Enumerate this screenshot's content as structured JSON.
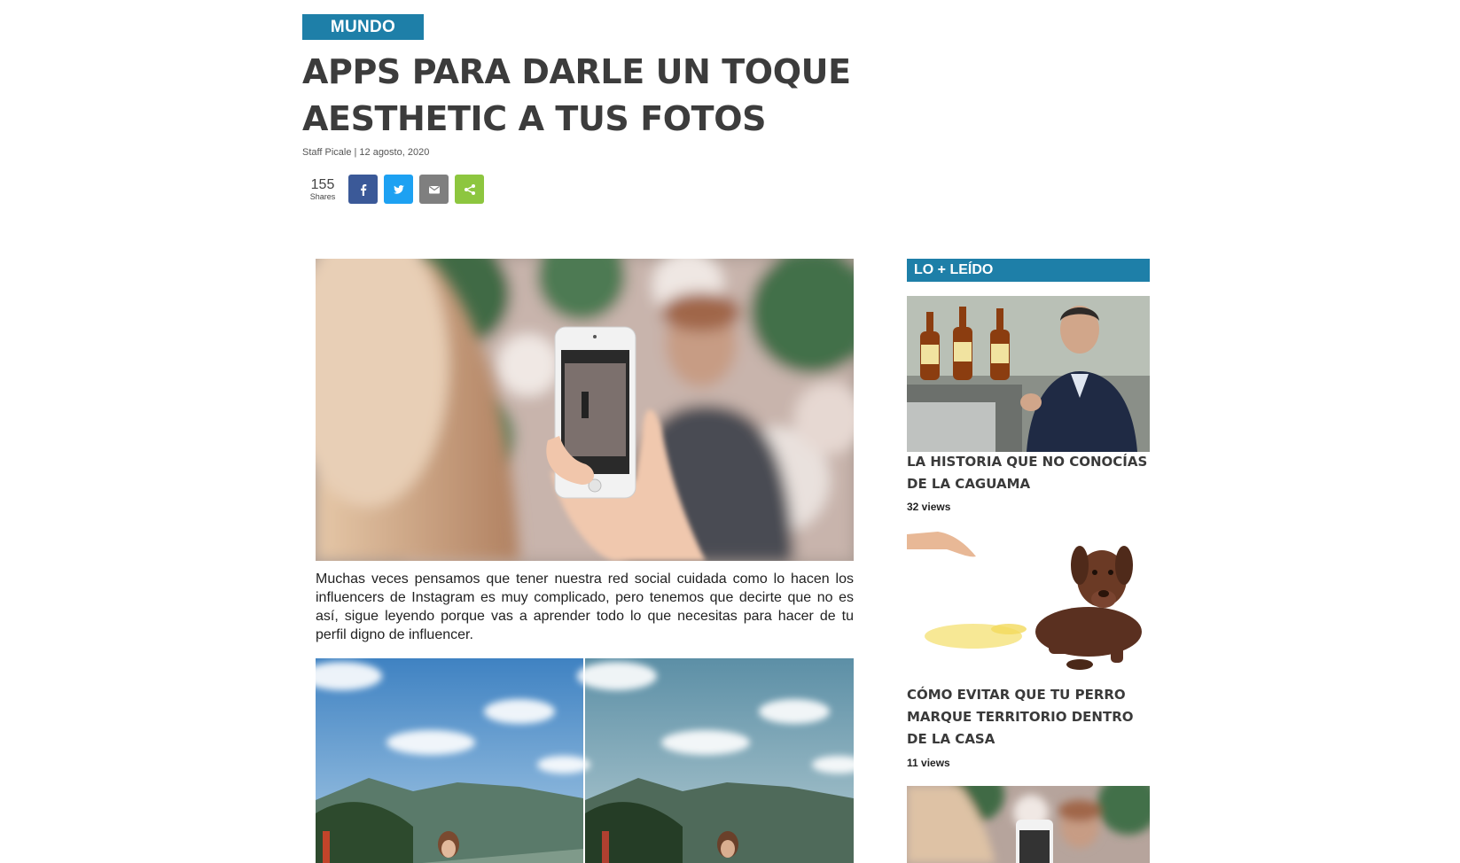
{
  "article": {
    "category": "MUNDO",
    "title": "APPS PARA DARLE UN TOQUE AESTHETIC A TUS FOTOS",
    "byline": "Staff Picale | 12 agosto, 2020",
    "shares_count": "155",
    "shares_label": "Shares",
    "intro": "Muchas veces pensamos que tener nuestra red social cuidada como lo hacen los influencers de Instagram es muy complicado, pero tenemos que decirte que no es así, sigue leyendo porque vas a aprender todo lo que necesitas para hacer de tu perfil digno de influencer."
  },
  "share_buttons": [
    {
      "icon": "facebook-icon",
      "color": "#3b5998"
    },
    {
      "icon": "twitter-icon",
      "color": "#1da1f2"
    },
    {
      "icon": "email-icon",
      "color": "#7f7f7f"
    },
    {
      "icon": "share-icon",
      "color": "#8dc63f"
    }
  ],
  "sidebar": {
    "header": "LO + LEÍDO",
    "items": [
      {
        "title": "LA HISTORIA QUE NO CONOCÍAS DE LA CAGUAMA",
        "views": "32 views"
      },
      {
        "title": "CÓMO EVITAR QUE TU PERRO MARQUE TERRITORIO DENTRO DE LA CASA",
        "views": "11 views"
      }
    ]
  },
  "colors": {
    "accent": "#1e7fa8",
    "title": "#3c3c3c"
  }
}
